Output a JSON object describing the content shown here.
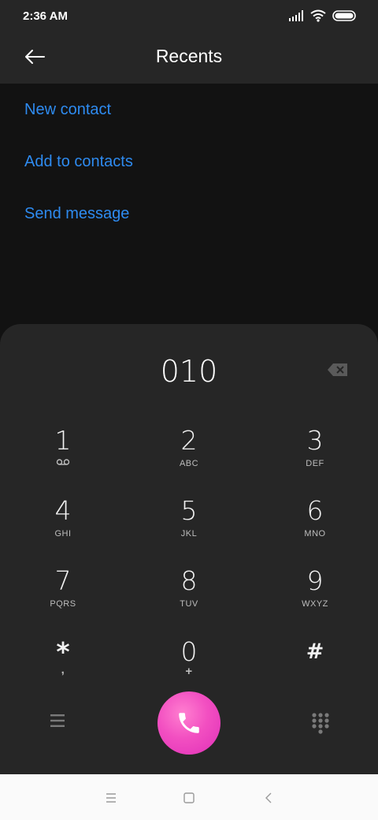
{
  "status_bar": {
    "time": "2:36 AM",
    "icons": [
      "signal-icon",
      "wifi-icon",
      "battery-icon"
    ]
  },
  "header": {
    "title": "Recents",
    "back_icon": "back-arrow-icon"
  },
  "actions": [
    {
      "label": "New contact"
    },
    {
      "label": "Add to contacts"
    },
    {
      "label": "Send message"
    }
  ],
  "dialer": {
    "number": "010",
    "keys": [
      {
        "digit": "1",
        "letters": ""
      },
      {
        "digit": "2",
        "letters": "ABC"
      },
      {
        "digit": "3",
        "letters": "DEF"
      },
      {
        "digit": "4",
        "letters": "GHI"
      },
      {
        "digit": "5",
        "letters": "JKL"
      },
      {
        "digit": "6",
        "letters": "MNO"
      },
      {
        "digit": "7",
        "letters": "PQRS"
      },
      {
        "digit": "8",
        "letters": "TUV"
      },
      {
        "digit": "9",
        "letters": "WXYZ"
      },
      {
        "digit": "*",
        "letters": ","
      },
      {
        "digit": "0",
        "letters": "+"
      },
      {
        "digit": "#",
        "letters": ""
      }
    ]
  },
  "colors": {
    "accent": "#2e8bf0",
    "call_button": "#f24fc1",
    "panel": "#262626",
    "background": "#121212"
  },
  "nav_bar": {
    "icons": [
      "recent-apps-icon",
      "home-icon",
      "back-icon"
    ]
  }
}
